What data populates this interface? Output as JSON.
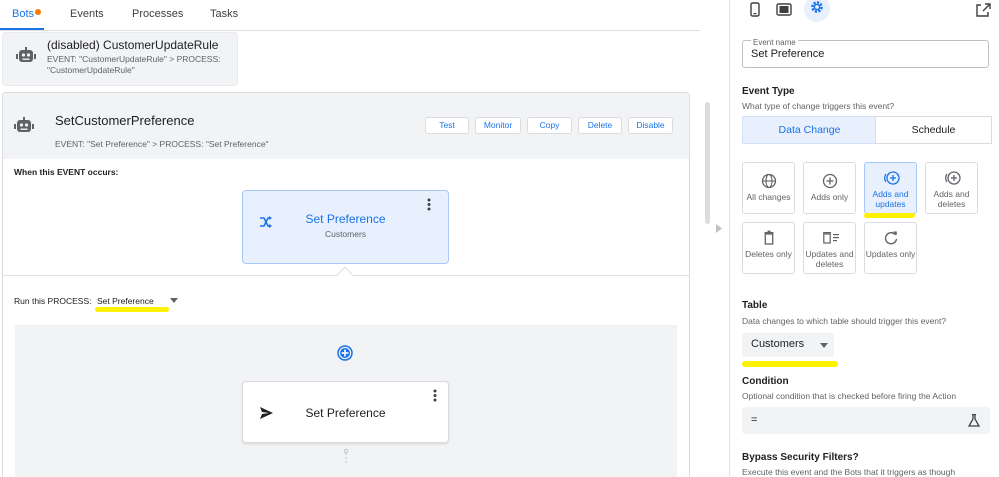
{
  "tabs": [
    {
      "label": "Bots"
    },
    {
      "label": "Events"
    },
    {
      "label": "Processes"
    },
    {
      "label": "Tasks"
    }
  ],
  "disabled_bot": {
    "title": "(disabled) CustomerUpdateRule",
    "subtitle": "EVENT: \"CustomerUpdateRule\" > PROCESS: \"CustomerUpdateRule\""
  },
  "bot": {
    "title": "SetCustomerPreference",
    "subtitle": "EVENT: \"Set Preference\" > PROCESS: \"Set Preference\"",
    "buttons": {
      "test": "Test",
      "monitor": "Monitor",
      "copy": "Copy",
      "delete": "Delete",
      "disable": "Disable"
    },
    "when_label": "When this EVENT occurs:",
    "event_card": {
      "title": "Set Preference",
      "subtitle": "Customers"
    },
    "run_label": "Run this PROCESS:",
    "process_value": "Set Preference",
    "step_card": {
      "title": "Set Preference"
    }
  },
  "panel": {
    "event_name": {
      "label": "Event name",
      "value": "Set Preference"
    },
    "event_type": {
      "title": "Event Type",
      "desc": "What type of change triggers this event?",
      "segments": [
        "Data Change",
        "Schedule"
      ],
      "options": [
        {
          "label": "All changes",
          "icon": "globe-icon"
        },
        {
          "label": "Adds only",
          "icon": "add-circle-icon"
        },
        {
          "label": "Adds and updates",
          "icon": "add-circle-refresh-icon"
        },
        {
          "label": "Adds and deletes",
          "icon": "add-circle-icon"
        },
        {
          "label": "Deletes only",
          "icon": "trash-icon"
        },
        {
          "label": "Updates and deletes",
          "icon": "trash-list-icon"
        },
        {
          "label": "Updates only",
          "icon": "refresh-icon"
        }
      ]
    },
    "table": {
      "title": "Table",
      "desc": "Data changes to which table should trigger this event?",
      "value": "Customers"
    },
    "condition": {
      "title": "Condition",
      "desc": "Optional condition that is checked before firing the Action",
      "value": "="
    },
    "bypass": {
      "title": "Bypass Security Filters?",
      "desc": "Execute this event and the Bots that it triggers as though"
    }
  },
  "colors": {
    "accent": "#1a73e8",
    "highlight": "#fff200",
    "selected_bg": "#e8f0fe",
    "notification_dot": "#f57c00"
  }
}
